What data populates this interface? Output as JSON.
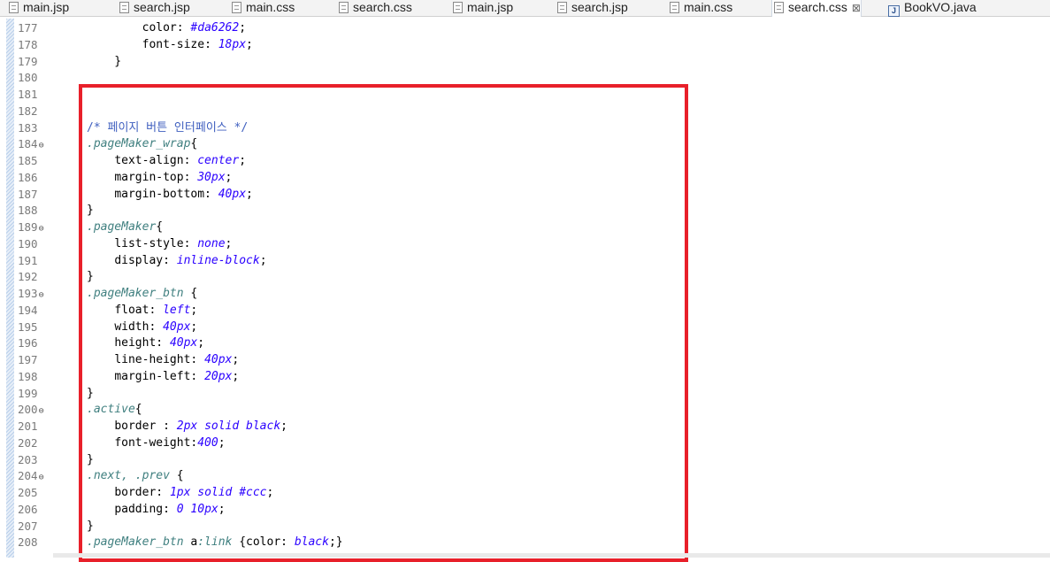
{
  "tabs": [
    {
      "label": "main.jsp",
      "type": "file"
    },
    {
      "label": "search.jsp",
      "type": "file"
    },
    {
      "label": "main.css",
      "type": "file"
    },
    {
      "label": "search.css",
      "type": "file"
    },
    {
      "label": "main.jsp",
      "type": "file"
    },
    {
      "label": "search.jsp",
      "type": "file"
    },
    {
      "label": "main.css",
      "type": "file"
    },
    {
      "label": "search.css",
      "type": "file",
      "active": true,
      "close": "⊠"
    },
    {
      "label": "BookVO.java",
      "type": "java"
    }
  ],
  "colors": {
    "highlight_border": "#e8202a",
    "selector": "#3f7f7f",
    "value": "#2a00ff",
    "comment": "#3f5fbf"
  },
  "lines": [
    {
      "num": "177",
      "fold": "",
      "tokens": [
        {
          "t": "        ",
          "k": "pun"
        },
        {
          "t": "color: ",
          "k": "prop"
        },
        {
          "t": "#da6262",
          "k": "val"
        },
        {
          "t": ";",
          "k": "pun"
        }
      ]
    },
    {
      "num": "178",
      "fold": "",
      "tokens": [
        {
          "t": "        ",
          "k": "pun"
        },
        {
          "t": "font-size: ",
          "k": "prop"
        },
        {
          "t": "18px",
          "k": "val"
        },
        {
          "t": ";",
          "k": "pun"
        }
      ]
    },
    {
      "num": "179",
      "fold": "",
      "tokens": [
        {
          "t": "    }",
          "k": "pun"
        }
      ]
    },
    {
      "num": "180",
      "fold": "",
      "tokens": []
    },
    {
      "num": "181",
      "fold": "",
      "tokens": []
    },
    {
      "num": "182",
      "fold": "",
      "tokens": []
    },
    {
      "num": "183",
      "fold": "",
      "tokens": [
        {
          "t": "/* 페이지 버튼 인터페이스 */",
          "k": "com"
        }
      ]
    },
    {
      "num": "184",
      "fold": "⊖",
      "tokens": [
        {
          "t": ".pageMaker_wrap",
          "k": "sel"
        },
        {
          "t": "{",
          "k": "pun"
        }
      ]
    },
    {
      "num": "185",
      "fold": "",
      "tokens": [
        {
          "t": "    ",
          "k": "pun"
        },
        {
          "t": "text-align: ",
          "k": "prop"
        },
        {
          "t": "center",
          "k": "val"
        },
        {
          "t": ";",
          "k": "pun"
        }
      ]
    },
    {
      "num": "186",
      "fold": "",
      "tokens": [
        {
          "t": "    ",
          "k": "pun"
        },
        {
          "t": "margin-top: ",
          "k": "prop"
        },
        {
          "t": "30px",
          "k": "val"
        },
        {
          "t": ";",
          "k": "pun"
        }
      ]
    },
    {
      "num": "187",
      "fold": "",
      "tokens": [
        {
          "t": "    ",
          "k": "pun"
        },
        {
          "t": "margin-bottom: ",
          "k": "prop"
        },
        {
          "t": "40px",
          "k": "val"
        },
        {
          "t": ";",
          "k": "pun"
        }
      ]
    },
    {
      "num": "188",
      "fold": "",
      "tokens": [
        {
          "t": "}",
          "k": "pun"
        }
      ]
    },
    {
      "num": "189",
      "fold": "⊖",
      "tokens": [
        {
          "t": ".pageMaker",
          "k": "sel"
        },
        {
          "t": "{",
          "k": "pun"
        }
      ]
    },
    {
      "num": "190",
      "fold": "",
      "tokens": [
        {
          "t": "    ",
          "k": "pun"
        },
        {
          "t": "list-style: ",
          "k": "prop"
        },
        {
          "t": "none",
          "k": "val"
        },
        {
          "t": ";",
          "k": "pun"
        }
      ]
    },
    {
      "num": "191",
      "fold": "",
      "tokens": [
        {
          "t": "    ",
          "k": "pun"
        },
        {
          "t": "display: ",
          "k": "prop"
        },
        {
          "t": "inline-block",
          "k": "val"
        },
        {
          "t": ";",
          "k": "pun"
        }
      ]
    },
    {
      "num": "192",
      "fold": "",
      "tokens": [
        {
          "t": "}",
          "k": "pun"
        }
      ]
    },
    {
      "num": "193",
      "fold": "⊖",
      "tokens": [
        {
          "t": ".pageMaker_btn ",
          "k": "sel"
        },
        {
          "t": "{",
          "k": "pun"
        }
      ]
    },
    {
      "num": "194",
      "fold": "",
      "tokens": [
        {
          "t": "    ",
          "k": "pun"
        },
        {
          "t": "float: ",
          "k": "prop"
        },
        {
          "t": "left",
          "k": "val"
        },
        {
          "t": ";",
          "k": "pun"
        }
      ]
    },
    {
      "num": "195",
      "fold": "",
      "tokens": [
        {
          "t": "    ",
          "k": "pun"
        },
        {
          "t": "width: ",
          "k": "prop"
        },
        {
          "t": "40px",
          "k": "val"
        },
        {
          "t": ";",
          "k": "pun"
        }
      ]
    },
    {
      "num": "196",
      "fold": "",
      "tokens": [
        {
          "t": "    ",
          "k": "pun"
        },
        {
          "t": "height: ",
          "k": "prop"
        },
        {
          "t": "40px",
          "k": "val"
        },
        {
          "t": ";",
          "k": "pun"
        }
      ]
    },
    {
      "num": "197",
      "fold": "",
      "tokens": [
        {
          "t": "    ",
          "k": "pun"
        },
        {
          "t": "line-height: ",
          "k": "prop"
        },
        {
          "t": "40px",
          "k": "val"
        },
        {
          "t": ";",
          "k": "pun"
        }
      ]
    },
    {
      "num": "198",
      "fold": "",
      "tokens": [
        {
          "t": "    ",
          "k": "pun"
        },
        {
          "t": "margin-left: ",
          "k": "prop"
        },
        {
          "t": "20px",
          "k": "val"
        },
        {
          "t": ";",
          "k": "pun"
        }
      ]
    },
    {
      "num": "199",
      "fold": "",
      "tokens": [
        {
          "t": "}",
          "k": "pun"
        }
      ]
    },
    {
      "num": "200",
      "fold": "⊖",
      "tokens": [
        {
          "t": ".active",
          "k": "sel"
        },
        {
          "t": "{",
          "k": "pun"
        }
      ]
    },
    {
      "num": "201",
      "fold": "",
      "tokens": [
        {
          "t": "    ",
          "k": "pun"
        },
        {
          "t": "border : ",
          "k": "prop"
        },
        {
          "t": "2px solid black",
          "k": "val"
        },
        {
          "t": ";",
          "k": "pun"
        }
      ]
    },
    {
      "num": "202",
      "fold": "",
      "tokens": [
        {
          "t": "    ",
          "k": "pun"
        },
        {
          "t": "font-weight:",
          "k": "prop"
        },
        {
          "t": "400",
          "k": "val"
        },
        {
          "t": ";",
          "k": "pun"
        }
      ]
    },
    {
      "num": "203",
      "fold": "",
      "tokens": [
        {
          "t": "}",
          "k": "pun"
        }
      ]
    },
    {
      "num": "204",
      "fold": "⊖",
      "tokens": [
        {
          "t": ".next, .prev ",
          "k": "sel"
        },
        {
          "t": "{",
          "k": "pun"
        }
      ]
    },
    {
      "num": "205",
      "fold": "",
      "tokens": [
        {
          "t": "    ",
          "k": "pun"
        },
        {
          "t": "border: ",
          "k": "prop"
        },
        {
          "t": "1px solid #ccc",
          "k": "val"
        },
        {
          "t": ";",
          "k": "pun"
        }
      ]
    },
    {
      "num": "206",
      "fold": "",
      "tokens": [
        {
          "t": "    ",
          "k": "pun"
        },
        {
          "t": "padding: ",
          "k": "prop"
        },
        {
          "t": "0 10px",
          "k": "val"
        },
        {
          "t": ";",
          "k": "pun"
        }
      ]
    },
    {
      "num": "207",
      "fold": "",
      "tokens": [
        {
          "t": "}",
          "k": "pun"
        }
      ]
    },
    {
      "num": "208",
      "fold": "",
      "tokens": [
        {
          "t": ".pageMaker_btn ",
          "k": "sel"
        },
        {
          "t": "a",
          "k": "prop"
        },
        {
          "t": ":link",
          "k": "sel"
        },
        {
          "t": " {",
          "k": "pun"
        },
        {
          "t": "color: ",
          "k": "prop"
        },
        {
          "t": "black",
          "k": "val"
        },
        {
          "t": ";}",
          "k": "pun"
        }
      ]
    }
  ]
}
